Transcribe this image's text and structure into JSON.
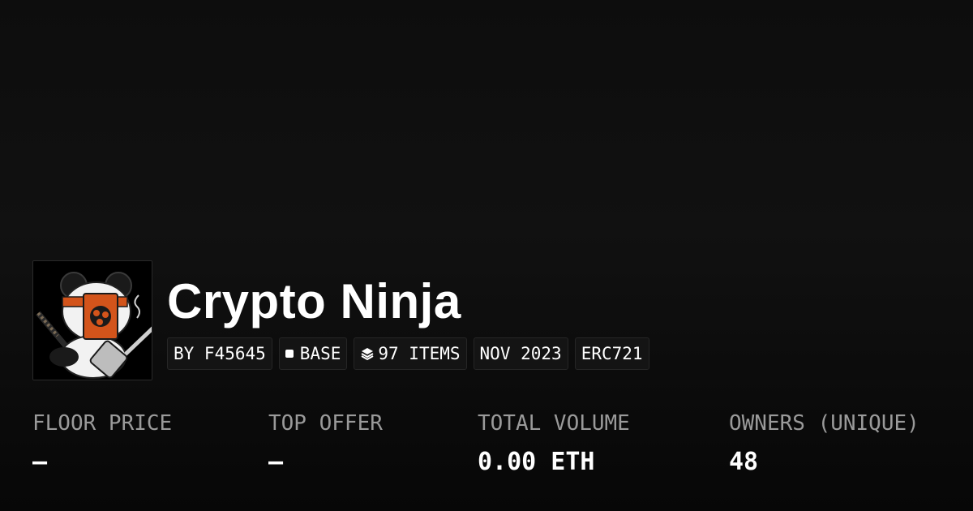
{
  "collection": {
    "name": "Crypto Ninja",
    "avatar_icon": "panda-ninja-avatar"
  },
  "tags": {
    "creator": "BY F45645",
    "chain": "BASE",
    "items": "97 ITEMS",
    "date": "NOV 2023",
    "standard": "ERC721"
  },
  "stats": {
    "floor_price": {
      "label": "FLOOR PRICE",
      "value": "–"
    },
    "top_offer": {
      "label": "TOP OFFER",
      "value": "–"
    },
    "total_volume": {
      "label": "TOTAL VOLUME",
      "value": "0.00 ETH"
    },
    "owners": {
      "label": "OWNERS (UNIQUE)",
      "value": "48"
    }
  },
  "colors": {
    "background": "#0d0d0d",
    "label": "#9a9a9a",
    "value": "#ffffff",
    "tag_bg": "#141414",
    "headband": "#d3541b"
  }
}
